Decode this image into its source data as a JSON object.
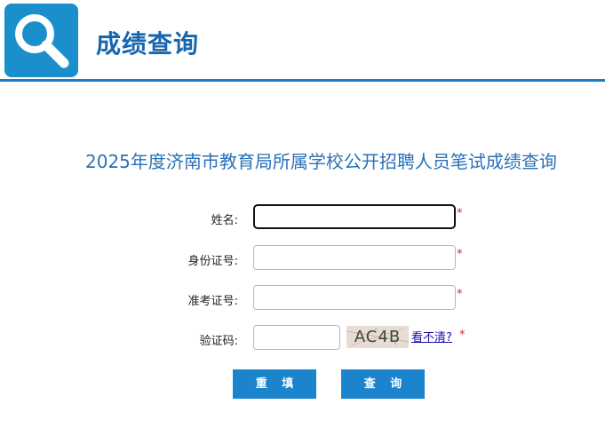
{
  "header": {
    "title": "成绩查询",
    "logo_icon": "search-icon",
    "accent_color": "#1a8fcc"
  },
  "page_title": "2025年度济南市教育局所属学校公开招聘人员笔试成绩查询",
  "form": {
    "name": {
      "label": "姓名:",
      "value": "",
      "required_mark": "*"
    },
    "id_number": {
      "label": "身份证号:",
      "value": "",
      "required_mark": "*"
    },
    "exam_number": {
      "label": "准考证号:",
      "value": "",
      "required_mark": "*"
    },
    "captcha": {
      "label": "验证码:",
      "value": "",
      "image_text": "AC4B",
      "refresh_link": "看不清?",
      "required_mark": "*"
    }
  },
  "buttons": {
    "reset": "重 填",
    "query": "查 询"
  }
}
